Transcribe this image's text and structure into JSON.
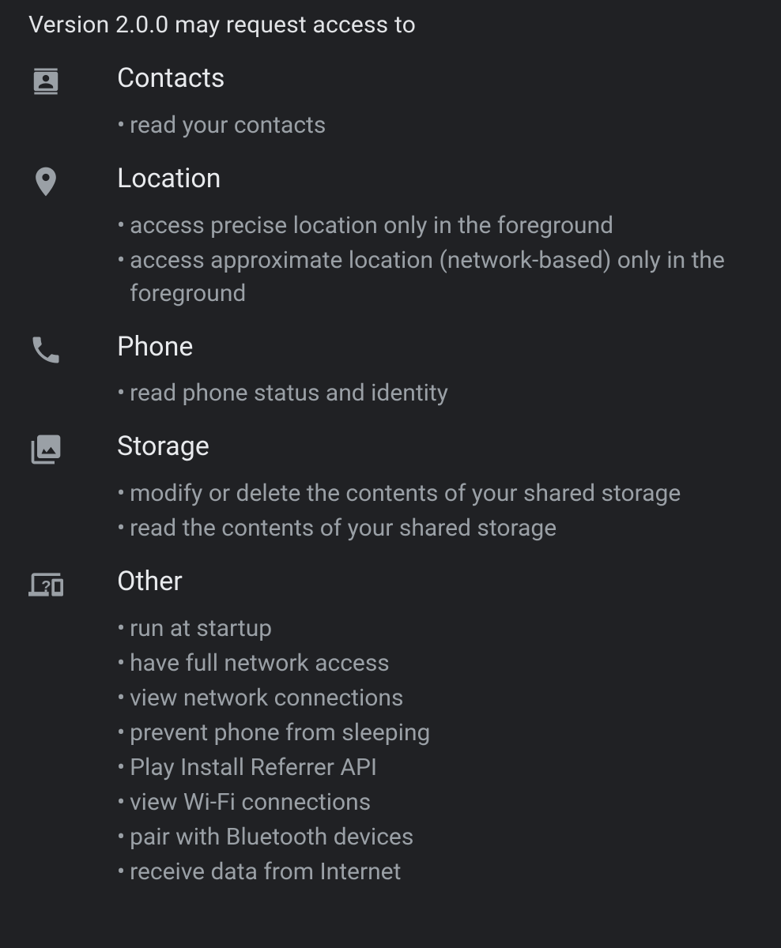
{
  "heading": "Version 2.0.0 may request access to",
  "groups": [
    {
      "icon": "contacts",
      "title": "Contacts",
      "details": [
        "read your contacts"
      ]
    },
    {
      "icon": "location",
      "title": "Location",
      "details": [
        "access precise location only in the foreground",
        "access approximate location (network-based) only in the foreground"
      ]
    },
    {
      "icon": "phone",
      "title": "Phone",
      "details": [
        "read phone status and identity"
      ]
    },
    {
      "icon": "storage",
      "title": "Storage",
      "details": [
        "modify or delete the contents of your shared storage",
        "read the contents of your shared storage"
      ]
    },
    {
      "icon": "other",
      "title": "Other",
      "details": [
        "run at startup",
        "have full network access",
        "view network connections",
        "prevent phone from sleeping",
        "Play Install Referrer API",
        "view Wi-Fi connections",
        "pair with Bluetooth devices",
        "receive data from Internet"
      ]
    }
  ]
}
